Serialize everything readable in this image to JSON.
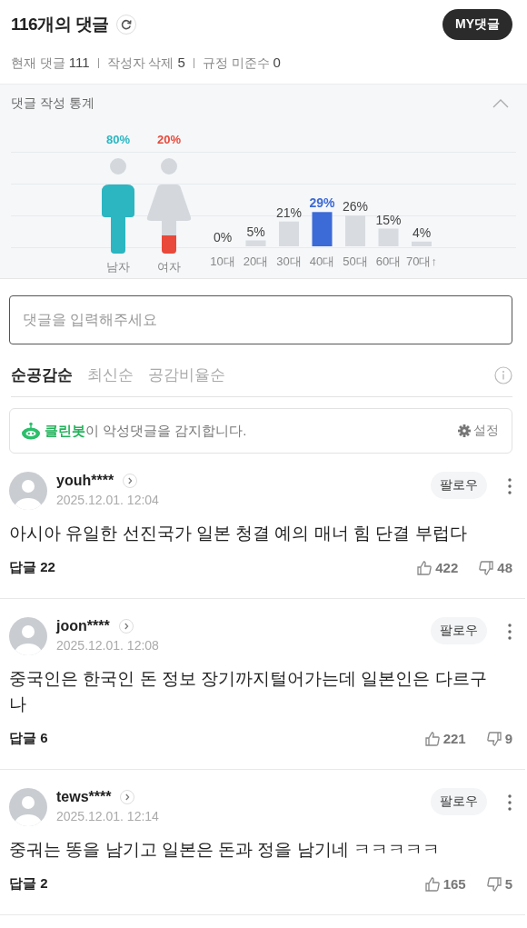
{
  "header": {
    "title": "116개의 댓글",
    "my_button": "MY댓글",
    "stats": [
      {
        "label": "현재 댓글",
        "value": "111"
      },
      {
        "label": "작성자 삭제",
        "value": "5"
      },
      {
        "label": "규정 미준수",
        "value": "0"
      }
    ]
  },
  "statistics": {
    "title": "댓글 작성 통계",
    "expanded": true,
    "gender": [
      {
        "kind": "male",
        "label": "남자",
        "reading": "80%",
        "color": "#2bb6c1"
      },
      {
        "kind": "female",
        "label": "여자",
        "reading": "20%",
        "color": "#e8493a"
      }
    ],
    "age_bars": [
      {
        "selected": false
      },
      {
        "selected": false
      },
      {
        "selected": false
      },
      {
        "selected": true
      },
      {
        "selected": false
      },
      {
        "selected": false
      },
      {
        "selected": false
      }
    ],
    "chart_data": {
      "type": "bar",
      "categories": [
        "10대",
        "20대",
        "30대",
        "40대",
        "50대",
        "60대",
        "70대↑"
      ],
      "values": [
        0,
        5,
        21,
        29,
        26,
        15,
        4
      ],
      "value_labels": [
        "0%",
        "5%",
        "21%",
        "29%",
        "26%",
        "15%",
        "4%"
      ]
    }
  },
  "comment_input": {
    "placeholder": "댓글을 입력해주세요"
  },
  "sort_tabs": [
    {
      "label": "순공감순",
      "selected": true
    },
    {
      "label": "최신순",
      "selected": false
    },
    {
      "label": "공감비율순",
      "selected": false
    }
  ],
  "cleanbot": {
    "name": "클린봇",
    "message": "이 악성댓글을 감지합니다.",
    "settings": "설정"
  },
  "comments": [
    {
      "user": "youh****",
      "time": "2025.12.01. 12:04",
      "follow": "팔로우",
      "text": "아시아 유일한 선진국가 일본 청결 예의 매너 힘 단결 부럽다",
      "replies": "답글 22",
      "likes": "422",
      "dislikes": "48"
    },
    {
      "user": "joon****",
      "time": "2025.12.01. 12:08",
      "follow": "팔로우",
      "text": "중국인은 한국인 돈 정보 장기까지털어가는데 일본인은 다르구나",
      "replies": "답글 6",
      "likes": "221",
      "dislikes": "9"
    },
    {
      "user": "tews****",
      "time": "2025.12.01. 12:14",
      "follow": "팔로우",
      "text": "중궈는 똥을 남기고 일본은 돈과 정을 남기네 ㅋㅋㅋㅋㅋ",
      "replies": "답글 2",
      "likes": "165",
      "dislikes": "5"
    }
  ]
}
